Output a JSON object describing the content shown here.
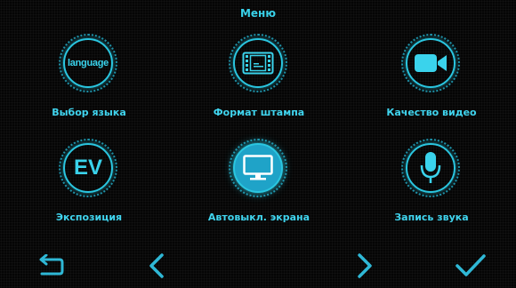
{
  "header": {
    "title": "Меню"
  },
  "menu": {
    "items": [
      {
        "label": "Выбор языка",
        "icon": "language-icon",
        "icon_text": "language"
      },
      {
        "label": "Формат штампа",
        "icon": "stamp-format-icon"
      },
      {
        "label": "Качество видео",
        "icon": "video-camera-icon"
      },
      {
        "label": "Экспозиция",
        "icon": "exposure-icon",
        "icon_text": "EV"
      },
      {
        "label": "Автовыкл. экрана",
        "icon": "monitor-icon",
        "selected": true
      },
      {
        "label": "Запись звука",
        "icon": "microphone-icon"
      }
    ]
  },
  "nav": {
    "buttons": [
      "back-icon",
      "previous-icon",
      "next-icon",
      "confirm-icon"
    ]
  },
  "colors": {
    "accent": "#3ad3ec",
    "selected": "#1fa3c8",
    "background": "#050505"
  }
}
